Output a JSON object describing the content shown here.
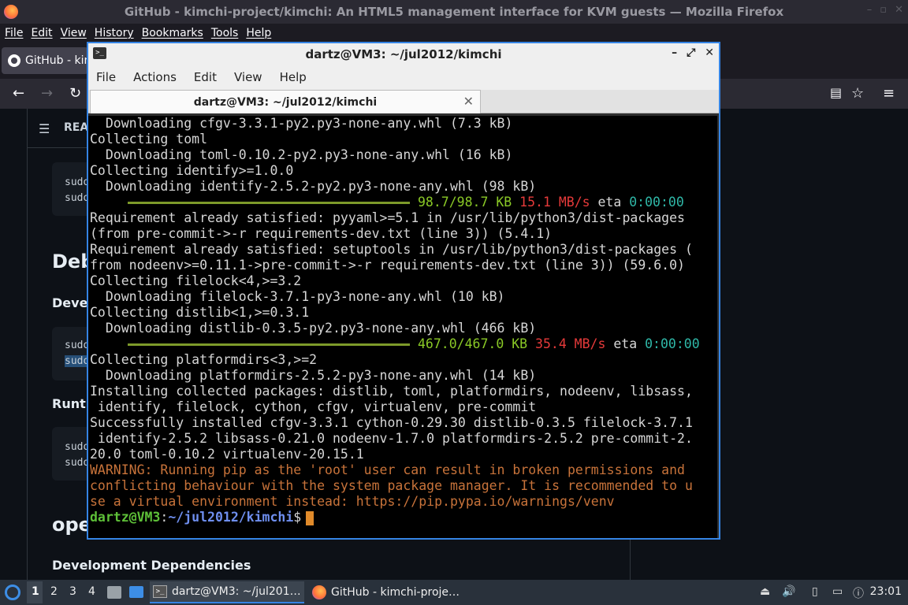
{
  "firefox": {
    "window_title": "GitHub - kimchi-project/kimchi: An HTML5 management interface for KVM guests — Mozilla Firefox",
    "menu": [
      "File",
      "Edit",
      "View",
      "History",
      "Bookmarks",
      "Tools",
      "Help"
    ],
    "tab_label": "GitHub - kim"
  },
  "github_page": {
    "readme_label": "REA",
    "code1": [
      "sudo",
      "sudo"
    ],
    "h2_debian": "Deb",
    "h3_devel": "Devel",
    "code2": [
      "sudo",
      "sudo"
    ],
    "h3_runtime": "Runtir",
    "code3": [
      "sudo",
      "sudo"
    ],
    "h2_opensuse": "ope",
    "h3_dev_deps": "Development Dependencies"
  },
  "terminal": {
    "window_title": "dartz@VM3: ~/jul2012/kimchi",
    "tab_title": "dartz@VM3: ~/jul2012/kimchi",
    "menu": [
      "File",
      "Actions",
      "Edit",
      "View",
      "Help"
    ],
    "lines": [
      "  Downloading cfgv-3.3.1-py2.py3-none-any.whl (7.3 kB)",
      "Collecting toml",
      "  Downloading toml-0.10.2-py2.py3-none-any.whl (16 kB)",
      "Collecting identify>=1.0.0",
      "  Downloading identify-2.5.2-py2.py3-none-any.whl (98 kB)"
    ],
    "progress1": {
      "size": "98.7/98.7 KB",
      "speed": "15.1 MB/s",
      "eta_label": "eta",
      "eta": "0:00:00"
    },
    "lines2": [
      "Requirement already satisfied: pyyaml>=5.1 in /usr/lib/python3/dist-packages",
      "(from pre-commit->-r requirements-dev.txt (line 3)) (5.4.1)",
      "Requirement already satisfied: setuptools in /usr/lib/python3/dist-packages (",
      "from nodeenv>=0.11.1->pre-commit->-r requirements-dev.txt (line 3)) (59.6.0)",
      "Collecting filelock<4,>=3.2",
      "  Downloading filelock-3.7.1-py3-none-any.whl (10 kB)",
      "Collecting distlib<1,>=0.3.1",
      "  Downloading distlib-0.3.5-py2.py3-none-any.whl (466 kB)"
    ],
    "progress2": {
      "size": "467.0/467.0 KB",
      "speed": "35.4 MB/s",
      "eta_label": "eta",
      "eta": "0:00:00"
    },
    "lines3": [
      "Collecting platformdirs<3,>=2",
      "  Downloading platformdirs-2.5.2-py3-none-any.whl (14 kB)",
      "Installing collected packages: distlib, toml, platformdirs, nodeenv, libsass,",
      " identify, filelock, cython, cfgv, virtualenv, pre-commit",
      "Successfully installed cfgv-3.3.1 cython-0.29.30 distlib-0.3.5 filelock-3.7.1",
      " identify-2.5.2 libsass-0.21.0 nodeenv-1.7.0 platformdirs-2.5.2 pre-commit-2.",
      "20.0 toml-0.10.2 virtualenv-20.15.1"
    ],
    "warning": [
      "WARNING: Running pip as the 'root' user can result in broken permissions and",
      "conflicting behaviour with the system package manager. It is recommended to u",
      "se a virtual environment instead: https://pip.pypa.io/warnings/venv"
    ],
    "prompt": {
      "user": "dartz@VM3",
      "sep": ":",
      "path": "~/jul2012/kimchi",
      "symbol": "$"
    }
  },
  "taskbar": {
    "workspaces": [
      "1",
      "2",
      "3",
      "4"
    ],
    "task_terminal": "dartz@VM3: ~/jul201…",
    "task_firefox": "GitHub - kimchi-proje…",
    "clock": "23:01"
  }
}
